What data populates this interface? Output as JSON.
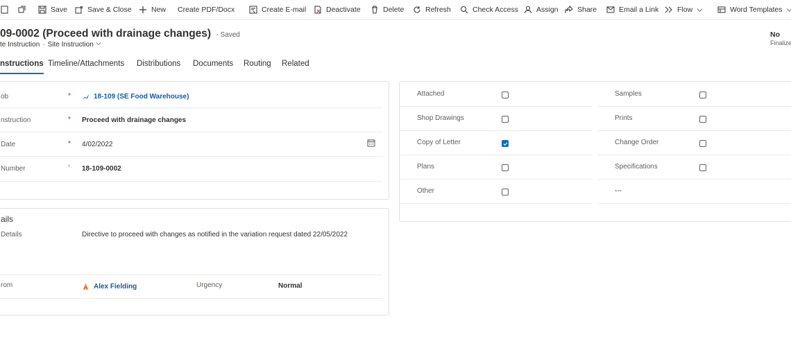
{
  "toolbar": {
    "save": "Save",
    "save_close": "Save & Close",
    "new": "New",
    "create_pdf": "Create PDF/Docx",
    "create_email": "Create E-mail",
    "deactivate": "Deactivate",
    "delete": "Delete",
    "refresh": "Refresh",
    "check_access": "Check Access",
    "assign": "Assign",
    "share": "Share",
    "email_link": "Email a Link",
    "flow": "Flow",
    "word_templates": "Word Templates"
  },
  "header": {
    "title": "09-0002 (Proceed with drainage changes)",
    "saved": "- Saved",
    "entity": "te Instruction",
    "form": "Site Instruction",
    "finalized_value": "No",
    "finalized_label": "Finalized"
  },
  "tabs": [
    "nstructions",
    "Timeline/Attachments",
    "Distributions",
    "Documents",
    "Routing",
    "Related"
  ],
  "general": {
    "job_label": "ob",
    "job_value": "18-109 (SE Food Warehouse)",
    "instruction_label": "nstruction",
    "instruction_value": "Proceed with drainage changes",
    "date_label": "Date",
    "date_value": "4/02/2022",
    "number_label": "Number",
    "number_value": "18-109-0002",
    "required_mark": "*",
    "optional_mark": "-"
  },
  "details": {
    "section_title": "ails",
    "details_label": "Details",
    "details_value": "Directive to proceed with changes as notified in the variation request dated 22/05/2022",
    "from_label": "rom",
    "from_value": "Alex Fielding",
    "urgency_label": "Urgency",
    "urgency_value": "Normal"
  },
  "attachments": {
    "left": [
      {
        "label": "Attached",
        "checked": false
      },
      {
        "label": "Shop Drawings",
        "checked": false
      },
      {
        "label": "Copy of Letter",
        "checked": true
      },
      {
        "label": "Plans",
        "checked": false
      },
      {
        "label": "Other",
        "checked": false
      }
    ],
    "right": [
      {
        "label": "Samples",
        "checked": false
      },
      {
        "label": "Prints",
        "checked": false
      },
      {
        "label": "Change Order",
        "checked": false
      },
      {
        "label": "Specifications",
        "checked": false
      }
    ],
    "empty_value": "---"
  },
  "colors": {
    "accent": "#0f6cbd",
    "link": "#115ea3",
    "required": "#a4262c"
  }
}
